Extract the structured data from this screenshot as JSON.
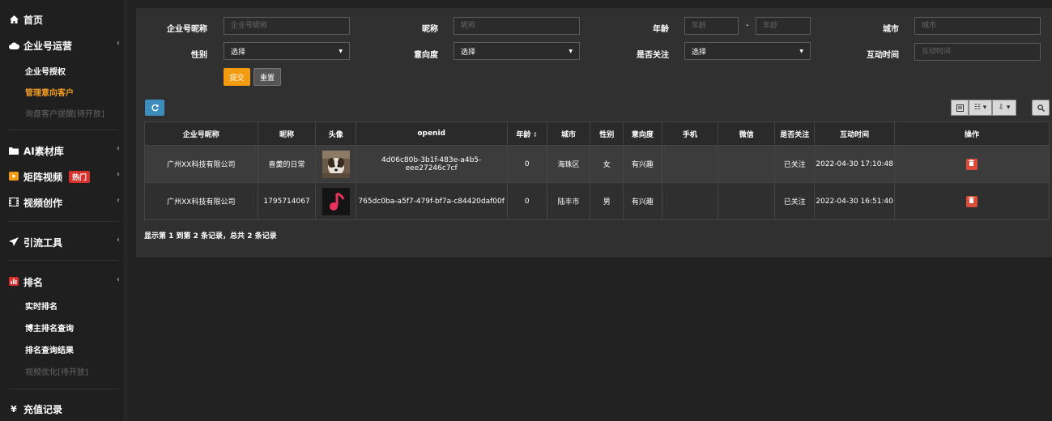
{
  "sidebar": {
    "home": {
      "label": "首页",
      "icon": "home-icon"
    },
    "groups": [
      {
        "label": "企业号运营",
        "icon": "cloud-icon"
      },
      {
        "label": "AI素材库",
        "icon": "folder-icon"
      },
      {
        "label": "矩阵视频",
        "icon": "play-badge-icon",
        "badge": "热门"
      },
      {
        "label": "视频创作",
        "icon": "film-icon"
      },
      {
        "label": "引流工具",
        "icon": "send-icon"
      },
      {
        "label": "排名",
        "icon": "bar-chart-icon"
      },
      {
        "label": "充值记录",
        "icon": "yen-icon"
      }
    ],
    "enterprise_sub": [
      "企业号授权",
      "管理意向客户",
      "询盘客户提醒[待开放]"
    ],
    "ranking_sub": [
      "实时排名",
      "博主排名查询",
      "排名查询结果",
      "视频优化[待开放]"
    ],
    "active_item": "管理意向客户"
  },
  "filters": {
    "company_nickname": {
      "label": "企业号昵称",
      "placeholder": "企业号昵称"
    },
    "nickname": {
      "label": "昵称",
      "placeholder": "昵称"
    },
    "age": {
      "label": "年龄",
      "placeholder_from": "年龄",
      "placeholder_to": "年龄",
      "separator": "-"
    },
    "city": {
      "label": "城市",
      "placeholder": "城市"
    },
    "gender": {
      "label": "性别",
      "value": "选择"
    },
    "intention": {
      "label": "意向度",
      "value": "选择"
    },
    "followed": {
      "label": "是否关注",
      "value": "选择"
    },
    "interact_time": {
      "label": "互动时间",
      "placeholder": "互动时间"
    },
    "submit_label": "提交",
    "reset_label": "重置"
  },
  "table": {
    "columns": [
      "企业号昵称",
      "昵称",
      "头像",
      "openid",
      "年龄",
      "城市",
      "性别",
      "意向度",
      "手机",
      "微信",
      "是否关注",
      "互动时间",
      "操作"
    ],
    "rows": [
      {
        "company": "广州XX科技有限公司",
        "nickname": "喜羹的日常",
        "avatar": "dog-photo-avatar",
        "openid": "4d06c80b-3b1f-483e-a4b5-eee27246c7cf",
        "age": "0",
        "city": "海珠区",
        "gender": "女",
        "intention": "有兴趣",
        "phone": "",
        "wechat": "",
        "followed": "已关注",
        "time": "2022-04-30 17:10:48"
      },
      {
        "company": "广州XX科技有限公司",
        "nickname": "1795714067",
        "avatar": "music-note-avatar",
        "openid": "765dc0ba-a5f7-479f-bf7a-c84420daf00f",
        "age": "0",
        "city": "陆丰市",
        "gender": "男",
        "intention": "有兴趣",
        "phone": "",
        "wechat": "",
        "followed": "已关注",
        "time": "2022-04-30 16:51:40"
      }
    ]
  },
  "pagination": {
    "summary": "显示第 1 到第 2 条记录，总共 2 条记录"
  },
  "colors": {
    "accent_orange": "#f39c12",
    "refresh_blue": "#3c8dbc",
    "delete_red": "#dd4b39",
    "followed_green": "#00a65a",
    "hot_badge_red": "#d9302c"
  }
}
